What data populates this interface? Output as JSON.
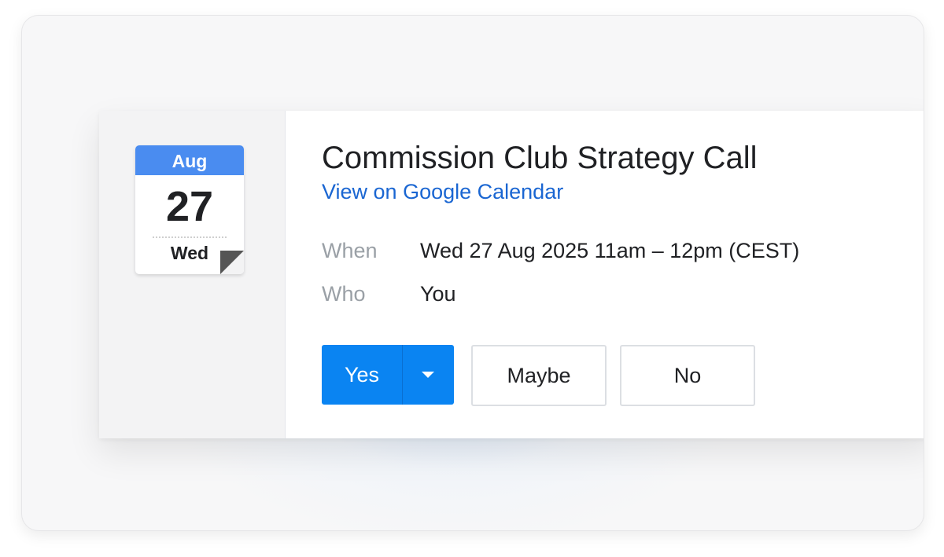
{
  "calendar_icon": {
    "month": "Aug",
    "day": "27",
    "weekday": "Wed"
  },
  "event": {
    "title": "Commission Club Strategy Call",
    "link_text": "View on Google Calendar"
  },
  "details": {
    "when_label": "When",
    "when_value": "Wed 27 Aug 2025 11am – 12pm (CEST)",
    "who_label": "Who",
    "who_value": "You"
  },
  "rsvp": {
    "yes_label": "Yes",
    "maybe_label": "Maybe",
    "no_label": "No"
  },
  "colors": {
    "accent": "#0a84f2",
    "link": "#1a66d2",
    "calendar_header": "#4a8cf0"
  },
  "icons": {
    "calendar": "calendar-date-icon",
    "dropdown": "caret-down-icon"
  }
}
